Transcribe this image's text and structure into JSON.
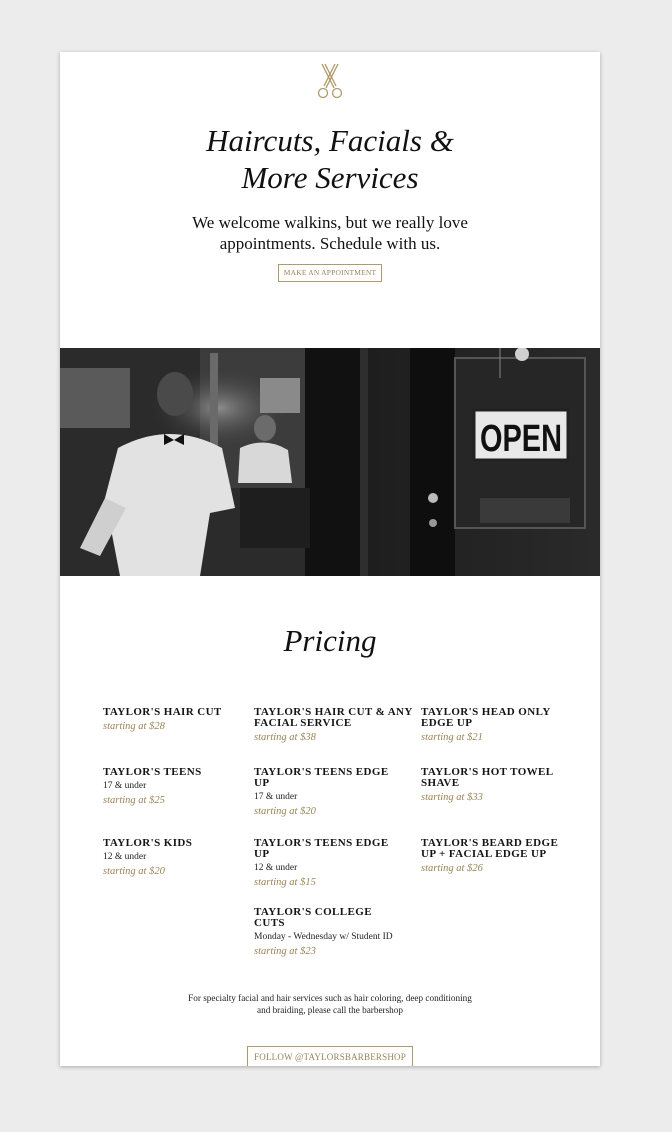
{
  "hero": {
    "title_line1": "Haircuts, Facials &",
    "title_line2": "More Services",
    "subtitle_line1": "We welcome walkins, but we really love",
    "subtitle_line2": "appointments.  Schedule with us.",
    "appointment_button": "MAKE AN APPOINTMENT"
  },
  "photo": {
    "sign_text": "OPEN"
  },
  "pricing": {
    "title": "Pricing",
    "items": [
      {
        "name": "TAYLOR'S HAIR CUT",
        "note": "",
        "price": "starting at $28"
      },
      {
        "name": "TAYLOR'S HAIR CUT & ANY FACIAL SERVICE",
        "note": "",
        "price": "starting at $38"
      },
      {
        "name": "TAYLOR'S HEAD ONLY EDGE UP",
        "note": "",
        "price": "starting at $21"
      },
      {
        "name": "TAYLOR'S TEENS",
        "note": "17 & under",
        "price": "starting at $25"
      },
      {
        "name": "TAYLOR'S TEENS EDGE UP",
        "note": "17 & under",
        "price": "starting at $20"
      },
      {
        "name": "TAYLOR'S HOT TOWEL SHAVE",
        "note": "",
        "price": "starting at $33"
      },
      {
        "name": "TAYLOR'S KIDS",
        "note": "12 & under",
        "price": "starting at $20"
      },
      {
        "name": "TAYLOR'S TEENS EDGE UP",
        "note": "12 & under",
        "price": "starting at $15"
      },
      {
        "name": "TAYLOR'S BEARD EDGE UP + FACIAL EDGE UP",
        "note": "",
        "price": "starting at $26"
      },
      {
        "name": "TAYLOR'S COLLEGE CUTS",
        "note": "Monday - Wednesday w/ Student ID",
        "price": "starting at $23"
      }
    ],
    "footnote_line1": "For specialty facial and hair services such as hair coloring, deep conditioning",
    "footnote_line2": "and braiding, please call the barbershop",
    "follow_button": "FOLLOW @TAYLORSBARBERSHOP"
  },
  "colors": {
    "accent_gold": "#9a8456",
    "page_background": "#ececec",
    "card_background": "#ffffff"
  }
}
